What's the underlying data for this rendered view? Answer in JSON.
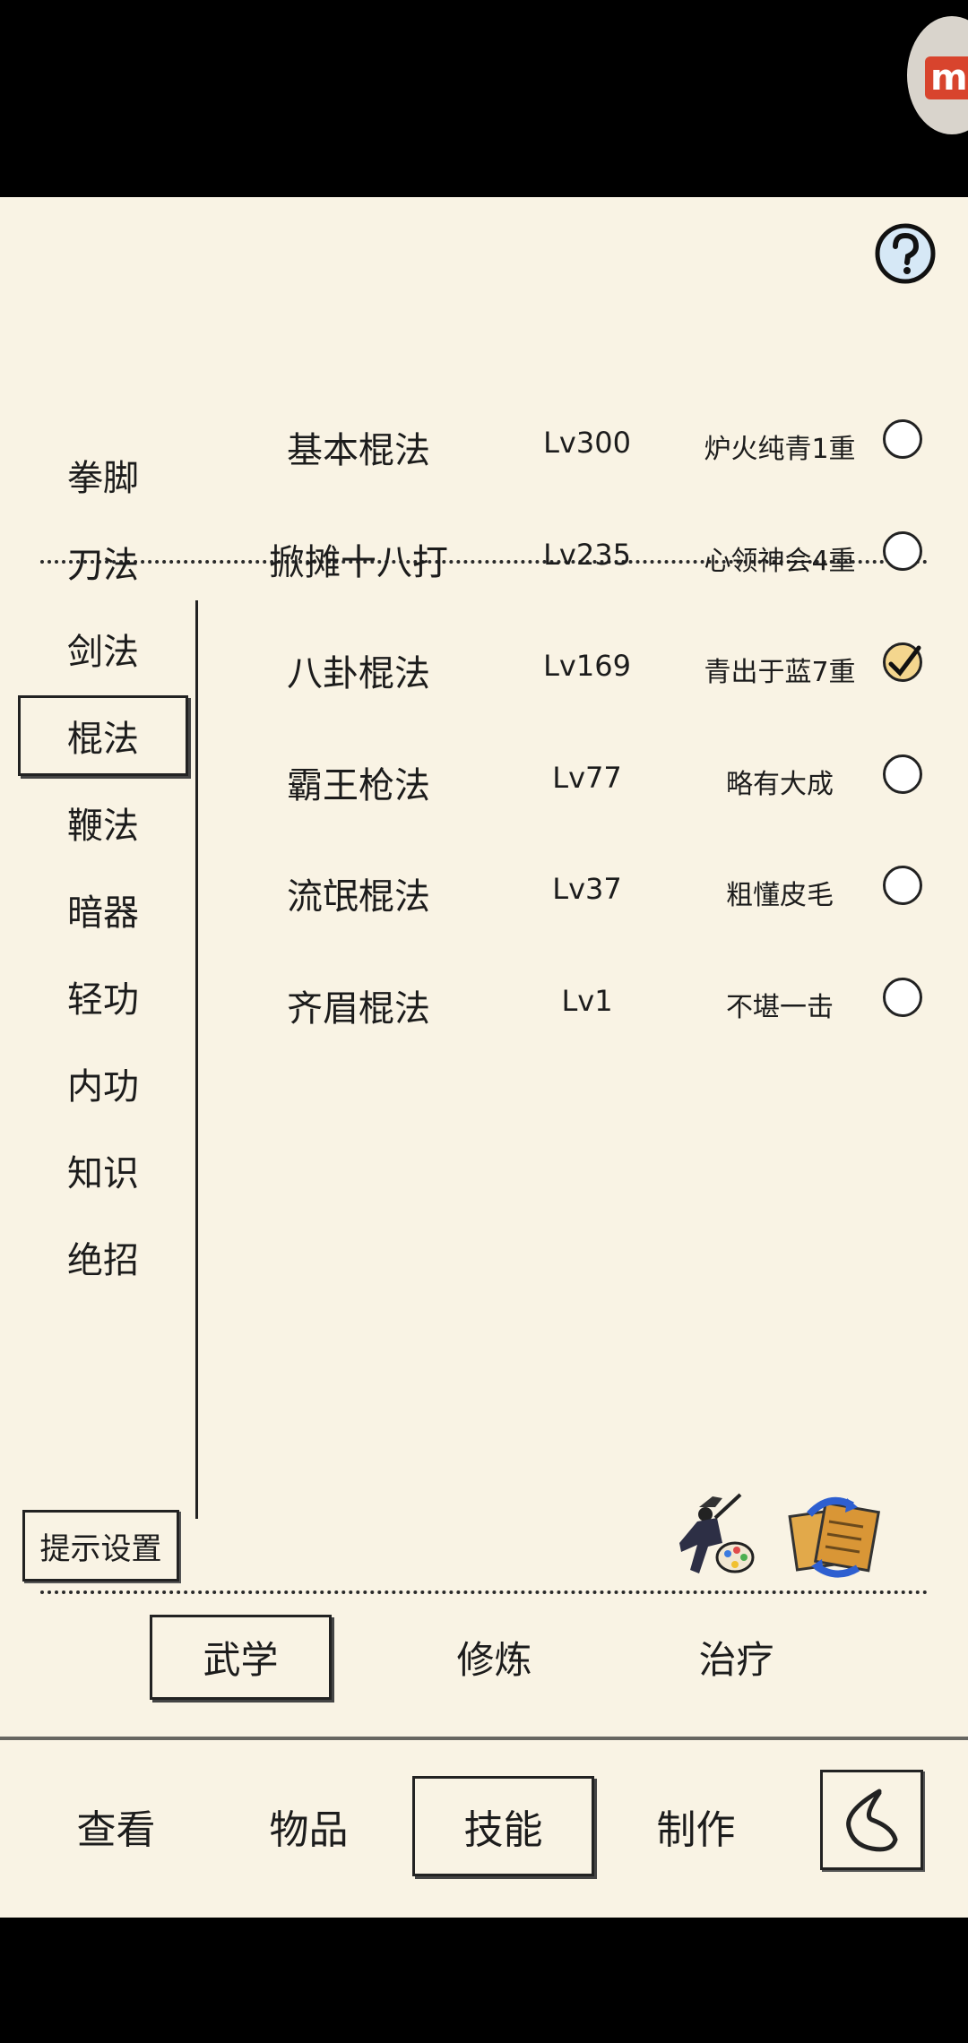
{
  "app": {
    "brand_icon": "m-logo-icon"
  },
  "help_icon": "question-icon",
  "categories": [
    {
      "label": "拳脚",
      "active": false
    },
    {
      "label": "刀法",
      "active": false
    },
    {
      "label": "剑法",
      "active": false
    },
    {
      "label": "棍法",
      "active": true
    },
    {
      "label": "鞭法",
      "active": false
    },
    {
      "label": "暗器",
      "active": false
    },
    {
      "label": "轻功",
      "active": false
    },
    {
      "label": "内功",
      "active": false
    },
    {
      "label": "知识",
      "active": false
    },
    {
      "label": "绝招",
      "active": false
    }
  ],
  "hint_settings_label": "提示设置",
  "skills": [
    {
      "name": "基本棍法",
      "level": "Lv300",
      "rank": "炉火纯青1重",
      "checked": false
    },
    {
      "name": "掀摊十八打",
      "level": "Lv235",
      "rank": "心领神会4重",
      "checked": false
    },
    {
      "name": "八卦棍法",
      "level": "Lv169",
      "rank": "青出于蓝7重",
      "checked": true
    },
    {
      "name": "霸王枪法",
      "level": "Lv77",
      "rank": "略有大成",
      "checked": false
    },
    {
      "name": "流氓棍法",
      "level": "Lv37",
      "rank": "粗懂皮毛",
      "checked": false
    },
    {
      "name": "齐眉棍法",
      "level": "Lv1",
      "rank": "不堪一击",
      "checked": false
    }
  ],
  "tools": [
    "warrior-palette-icon",
    "scroll-swap-icon"
  ],
  "sub_tabs": [
    {
      "label": "武学",
      "active": true
    },
    {
      "label": "修炼",
      "active": false
    },
    {
      "label": "治疗",
      "active": false
    }
  ],
  "bottom_tabs": [
    {
      "label": "查看",
      "active": false
    },
    {
      "label": "物品",
      "active": false
    },
    {
      "label": "技能",
      "active": true
    },
    {
      "label": "制作",
      "active": false
    }
  ],
  "back_icon": "back-arrow-icon"
}
